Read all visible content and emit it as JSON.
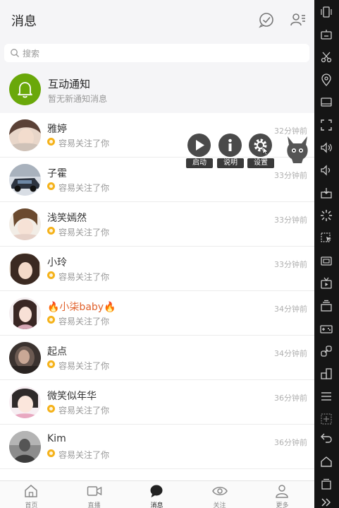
{
  "header": {
    "title": "消息"
  },
  "search": {
    "placeholder": "搜索"
  },
  "notification": {
    "title": "互动通知",
    "subtitle": "暂无新通知消息"
  },
  "messages": [
    {
      "name": "雅婷",
      "text": "容易关注了你",
      "time": "32分钟前"
    },
    {
      "name": "子霍",
      "text": "容易关注了你",
      "time": "33分钟前"
    },
    {
      "name": "浅笑嫣然",
      "text": "容易关注了你",
      "time": "33分钟前"
    },
    {
      "name": "小玲",
      "text": "容易关注了你",
      "time": "33分钟前"
    },
    {
      "name": "🔥小柒baby🔥",
      "text": "容易关注了你",
      "time": "34分钟前"
    },
    {
      "name": "起点",
      "text": "容易关注了你",
      "time": "34分钟前"
    },
    {
      "name": "微笑似年华",
      "text": "容易关注了你",
      "time": "36分钟前"
    },
    {
      "name": "Kim",
      "text": "容易关注了你",
      "time": "36分钟前"
    }
  ],
  "tabs": [
    {
      "label": "首页",
      "icon": "home-icon"
    },
    {
      "label": "直播",
      "icon": "video-icon"
    },
    {
      "label": "消息",
      "icon": "chat-icon"
    },
    {
      "label": "关注",
      "icon": "eye-icon"
    },
    {
      "label": "更多",
      "icon": "person-icon"
    }
  ],
  "floating_tools": [
    {
      "label": "启动",
      "icon": "play-icon"
    },
    {
      "label": "说明",
      "icon": "info-icon"
    },
    {
      "label": "设置",
      "icon": "gear-icon"
    }
  ],
  "emulator_sidebar": [
    "shake-icon",
    "keyboard-icon",
    "scissors-icon",
    "location-icon",
    "screen-icon",
    "fullscreen-icon",
    "volume-up-icon",
    "volume-down-icon",
    "apk-icon",
    "loading-icon",
    "macro-icon",
    "record-icon",
    "tv-icon",
    "multi-instance-icon",
    "gamepad-icon",
    "link-icon",
    "layout-icon",
    "menu-icon",
    "add-icon",
    "back-icon",
    "home-icon",
    "recent-apps-icon",
    "expand-icon"
  ],
  "colors": {
    "accent_green": "#6aa80a",
    "badge_orange": "#f5b21a",
    "special_name": "#e0602a",
    "header_bg": "#f5f5f7"
  }
}
